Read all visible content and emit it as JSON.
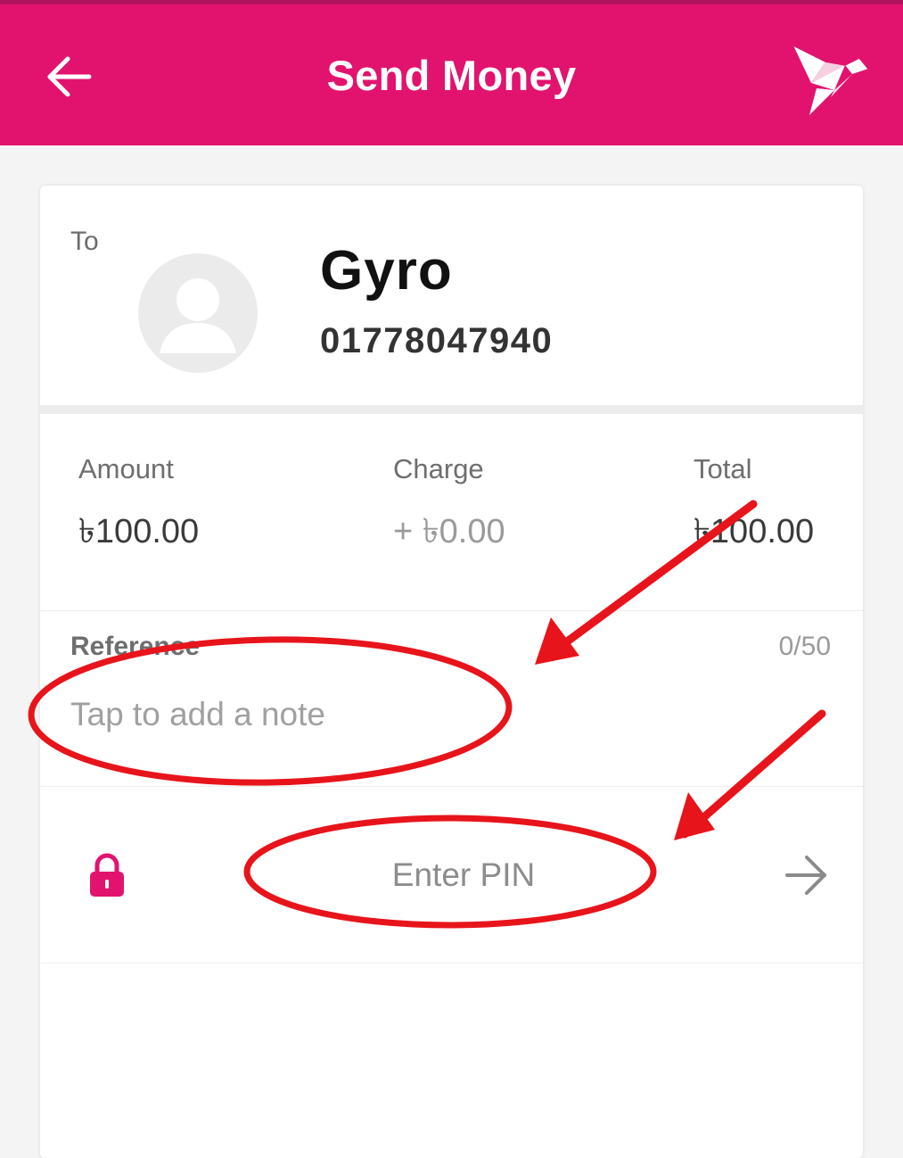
{
  "header": {
    "title": "Send Money",
    "back_icon": "arrow-left-icon",
    "logo_icon": "origami-bird-logo"
  },
  "recipient": {
    "to_label": "To",
    "name": "Gyro",
    "phone": "01778047940",
    "avatar_icon": "user-placeholder-icon"
  },
  "summary": {
    "amount_label": "Amount",
    "amount_value": "৳100.00",
    "charge_label": "Charge",
    "charge_value": "+ ৳0.00",
    "total_label": "Total",
    "total_value": "৳100.00"
  },
  "reference": {
    "label": "Reference",
    "counter": "0/50",
    "placeholder": "Tap to add a note"
  },
  "pin": {
    "placeholder": "Enter PIN",
    "lock_icon": "lock-icon",
    "next_icon": "arrow-right-icon"
  },
  "colors": {
    "brand": "#e2136e",
    "annotation": "#e8141b"
  }
}
